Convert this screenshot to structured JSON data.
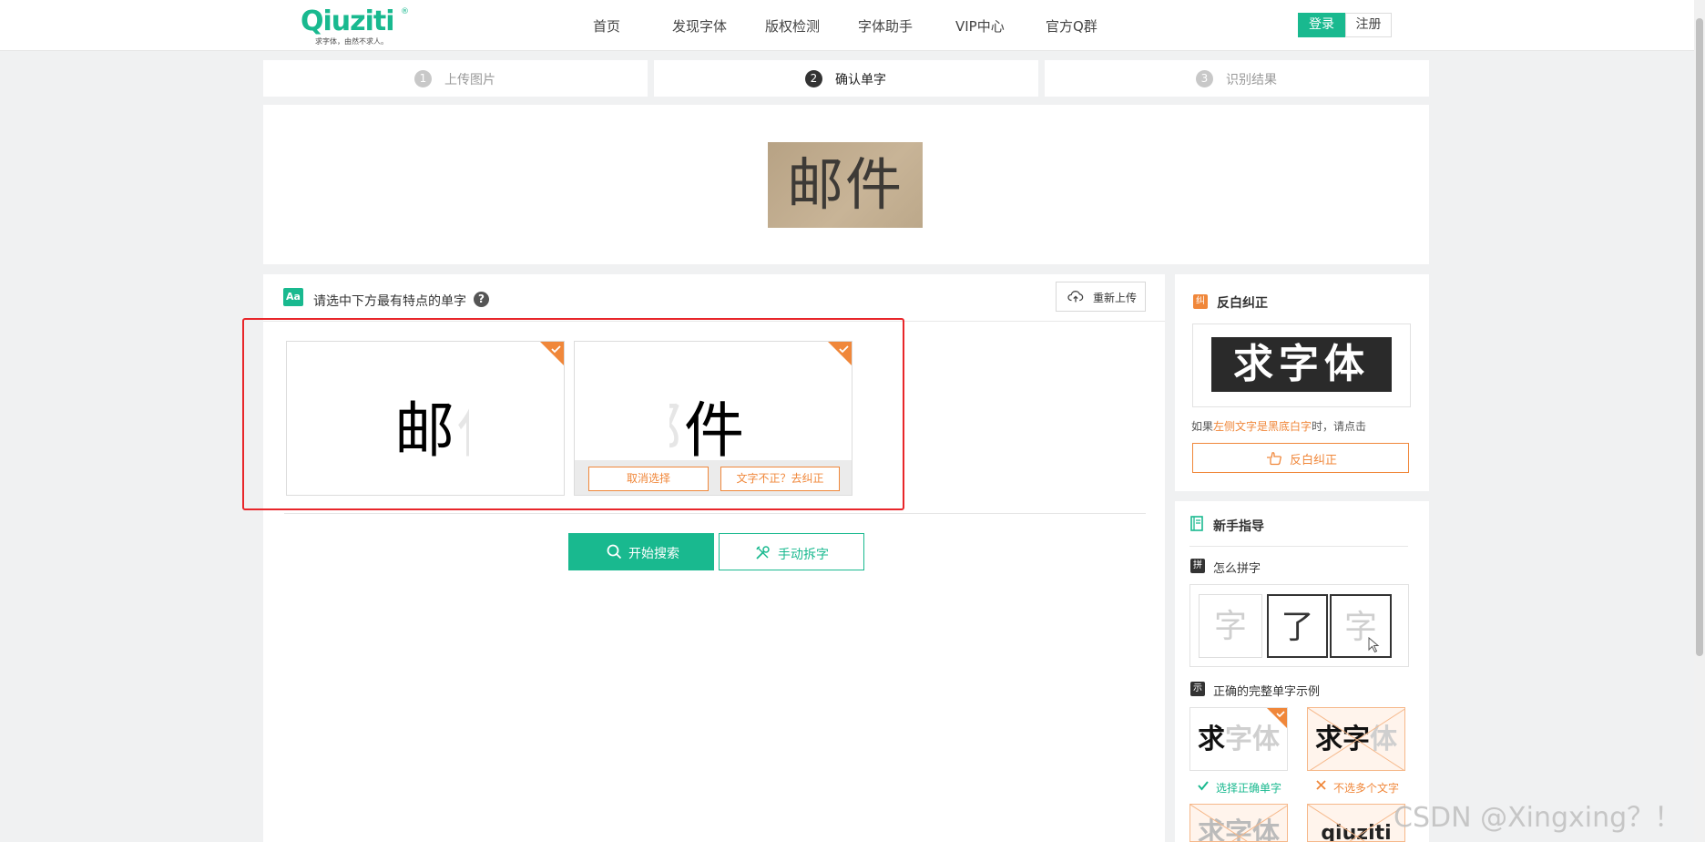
{
  "header": {
    "logo": {
      "word": "Qiuziti",
      "registered": "®",
      "slogan": "求字体，由然不求人。"
    },
    "nav": [
      "首页",
      "发现字体",
      "版权检测",
      "字体助手",
      "VIP中心",
      "官方Q群"
    ],
    "login": "登录",
    "register": "注册"
  },
  "steps": [
    {
      "num": "1",
      "label": "上传图片",
      "active": false
    },
    {
      "num": "2",
      "label": "确认单字",
      "active": true
    },
    {
      "num": "3",
      "label": "识别结果",
      "active": false
    }
  ],
  "preview": {
    "text": "邮件"
  },
  "main": {
    "icon_text": "Aa",
    "instruction": "请选中下方最有特点的单字",
    "help": "?",
    "reupload": "重新上传",
    "cards": [
      {
        "char": "邮",
        "selected": true
      },
      {
        "char": "件",
        "selected": true
      }
    ],
    "card_actions": {
      "cancel": "取消选择",
      "fix": "文字不正？去纠正"
    },
    "start_search": "开始搜索",
    "manual_split": "手动拆字"
  },
  "correction": {
    "icon_text": "纠",
    "title": "反白纠正",
    "sample": "求字体",
    "note_prefix": "如果",
    "note_highlight": "左侧文字是黑底白字",
    "note_suffix": "时，请点击",
    "button": "反白纠正"
  },
  "guide": {
    "title": "新手指导",
    "howto_icon_text": "拼",
    "howto_title": "怎么拼字",
    "howto_chars": [
      "字",
      "了",
      "字"
    ],
    "examples_icon_text": "示",
    "examples_title": "正确的完整单字示例",
    "examples": [
      {
        "text_dark": "求",
        "text_light": "字体",
        "caption": "选择正确单字",
        "ok": true
      },
      {
        "text_dark": "求字",
        "text_light": "体",
        "caption": "不选多个文字",
        "ok": false
      },
      {
        "text_dark": "求字体",
        "text_light": "",
        "caption": "",
        "ok": false
      },
      {
        "text_dark": "qiuziti",
        "text_light": "",
        "caption": "",
        "ok": false
      }
    ]
  },
  "watermark": "CSDN @Xingxing？！",
  "colors": {
    "brand": "#19b98f",
    "accent": "#f0873a",
    "highlight_red": "#e8262a"
  }
}
